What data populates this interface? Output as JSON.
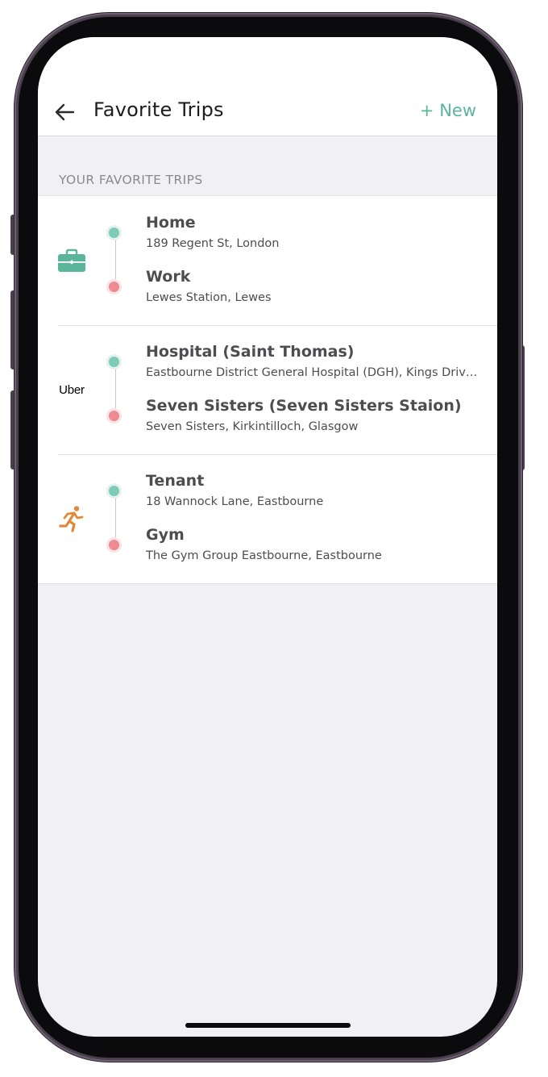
{
  "header": {
    "title": "Favorite Trips",
    "new_label": "+ New"
  },
  "section": {
    "label": "YOUR FAVORITE TRIPS"
  },
  "colors": {
    "accent": "#5bb59a",
    "origin_dot": "#7fcbb7",
    "destination_dot": "#ee8a93",
    "briefcase": "#5bb59a",
    "runner": "#e0893a"
  },
  "trips": [
    {
      "icon": "briefcase-icon",
      "origin": {
        "name": "Home",
        "address": "189 Regent St, London"
      },
      "destination": {
        "name": "Work",
        "address": "Lewes Station, Lewes"
      }
    },
    {
      "icon": "uber-logo",
      "logo_text": "Uber",
      "origin": {
        "name": "Hospital (Saint Thomas)",
        "address": "Eastbourne District General Hospital (DGH), Kings Drive, Eastbourne"
      },
      "destination": {
        "name": "Seven Sisters (Seven Sisters Staion)",
        "address": "Seven Sisters, Kirkintilloch, Glasgow"
      }
    },
    {
      "icon": "running-person-icon",
      "origin": {
        "name": "Tenant",
        "address": "18 Wannock Lane, Eastbourne"
      },
      "destination": {
        "name": "Gym",
        "address": "The Gym Group Eastbourne, Eastbourne"
      }
    }
  ]
}
